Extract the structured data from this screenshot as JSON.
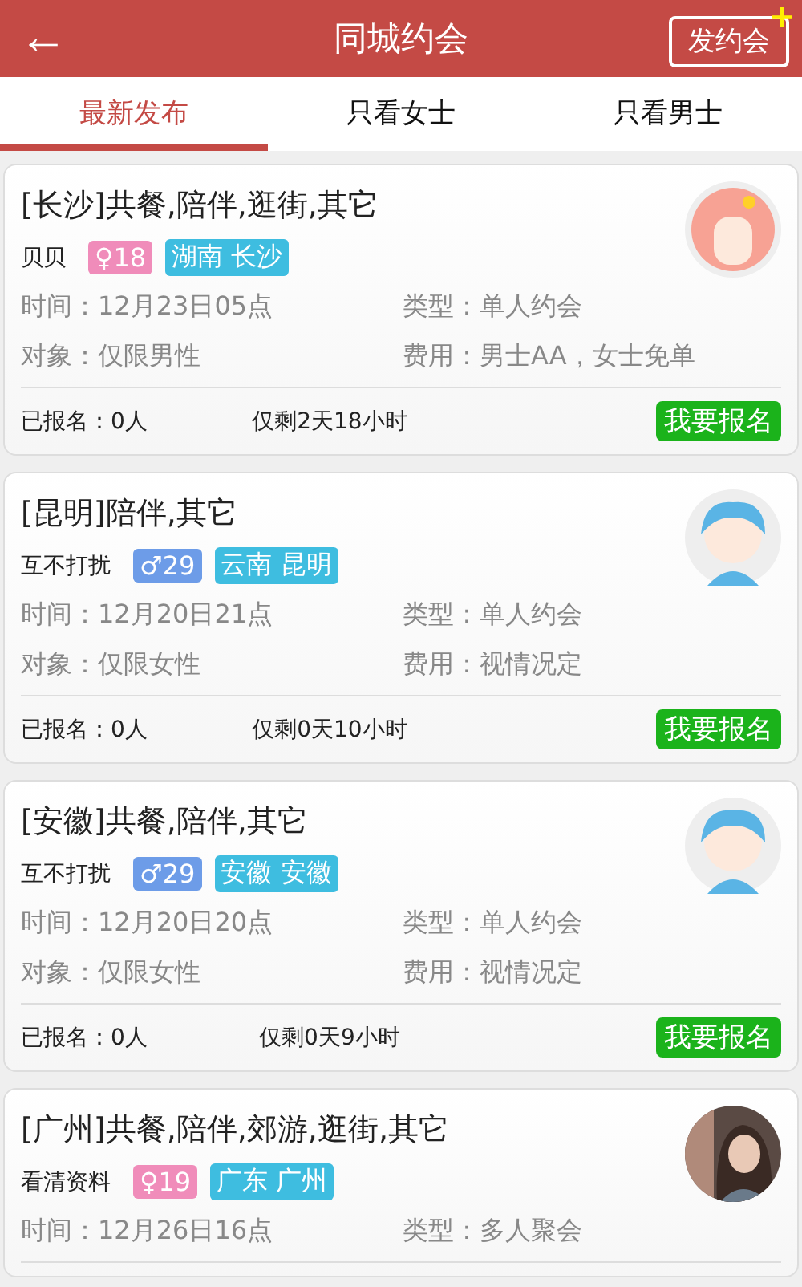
{
  "header": {
    "back": "←",
    "title": "同城约会",
    "action": "发约会",
    "action_plus": "+"
  },
  "tabs": [
    {
      "label": "最新发布",
      "selected": true
    },
    {
      "label": "只看女士",
      "selected": false
    },
    {
      "label": "只看男士",
      "selected": false
    }
  ],
  "posts": [
    {
      "title": "[长沙]共餐,陪伴,逛街,其它",
      "name": "贝贝",
      "color": "#f08cba",
      "age": "♀18",
      "location": "湖南 长沙",
      "kind": "female",
      "time": "时间：12月23日05点",
      "type": "类型：单人约会",
      "target": "对象：仅限男性",
      "fee": "费用：男士AA，女士免单",
      "signed": "已报名：0人",
      "remaining": "仅剩2天18小时",
      "button": "我要报名"
    },
    {
      "title": "[昆明]陪伴,其它",
      "name": "互不打扰",
      "color": "#6d9ce8",
      "age": "♂29",
      "location": "云南 昆明",
      "kind": "male",
      "time": "时间：12月20日21点",
      "type": "类型：单人约会",
      "target": "对象：仅限女性",
      "fee": "费用：视情况定",
      "signed": "已报名：0人",
      "remaining": "仅剩0天10小时",
      "button": "我要报名"
    },
    {
      "title": "[安徽]共餐,陪伴,其它",
      "name": "互不打扰",
      "color": "#6d9ce8",
      "age": "♂29",
      "location": "安徽 安徽",
      "kind": "male",
      "time": "时间：12月20日20点",
      "type": "类型：单人约会",
      "target": "对象：仅限女性",
      "fee": "费用：视情况定",
      "signed": "已报名：0人",
      "remaining": "仅剩0天9小时",
      "button": "我要报名"
    },
    {
      "title": "[广州]共餐,陪伴,郊游,逛街,其它",
      "name": "看清资料",
      "color": "#f08cba",
      "age": "♀19",
      "location": "广东 广州",
      "time": "时间：12月26日16点",
      "type": "类型：多人聚会"
    }
  ]
}
